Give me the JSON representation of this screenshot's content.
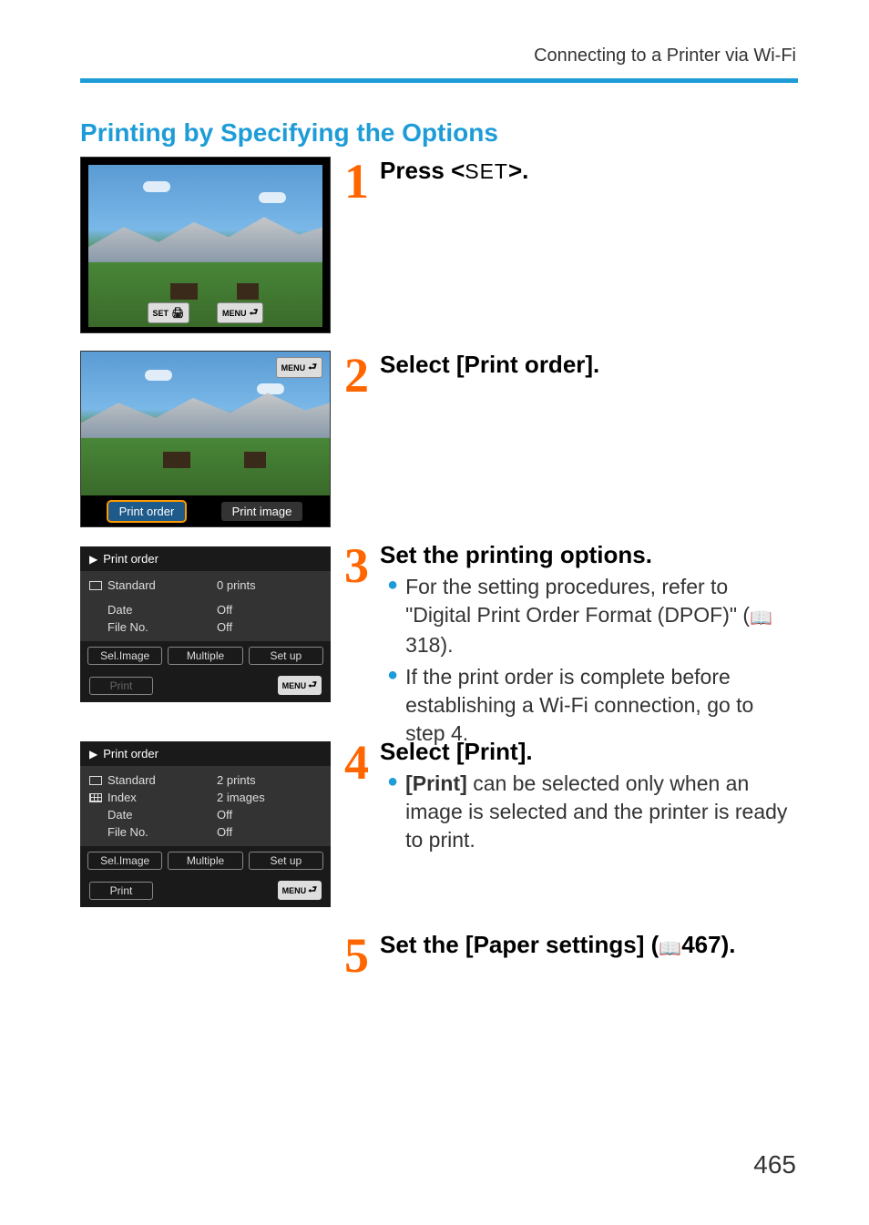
{
  "header": "Connecting to a Printer via Wi-Fi",
  "section_title": "Printing by Specifying the Options",
  "page_number": "465",
  "steps": {
    "s1": {
      "num": "1",
      "heading_prefix": "Press <",
      "heading_set": "SET",
      "heading_suffix": ">."
    },
    "s2": {
      "num": "2",
      "heading": "Select [Print order]."
    },
    "s3": {
      "num": "3",
      "heading": "Set the printing options.",
      "b1a": "For the setting procedures, refer to \"Digital Print Order Format (DPOF)\" (",
      "b1_ref": "318",
      "b1b": ").",
      "b2": "If the print order is complete before establishing a Wi-Fi connection, go to step 4."
    },
    "s4": {
      "num": "4",
      "heading": "Select [Print].",
      "b1_bold": "[Print]",
      "b1_rest": " can be selected only when an image is selected and the printer is ready to print."
    },
    "s5": {
      "num": "5",
      "heading_prefix": "Set the [Paper settings] (",
      "heading_ref": "467",
      "heading_suffix": ")."
    }
  },
  "cam1": {
    "set_label": "SET",
    "menu_label": "MENU"
  },
  "cam2": {
    "menu_label": "MENU",
    "tab_order": "Print order",
    "tab_image": "Print image"
  },
  "po3": {
    "title": "Print order",
    "rows": [
      {
        "label": "Standard",
        "value": "0 prints",
        "icon": "rect"
      },
      {
        "label": "Date",
        "value": "Off"
      },
      {
        "label": "File No.",
        "value": "Off"
      }
    ],
    "btns": [
      "Sel.Image",
      "Multiple",
      "Set up"
    ],
    "print": "Print",
    "menu_label": "MENU"
  },
  "po4": {
    "title": "Print order",
    "rows": [
      {
        "label": "Standard",
        "value": "2 prints",
        "icon": "rect"
      },
      {
        "label": "Index",
        "value": "2 images",
        "icon": "grid"
      },
      {
        "label": "Date",
        "value": "Off"
      },
      {
        "label": "File No.",
        "value": "Off"
      }
    ],
    "btns": [
      "Sel.Image",
      "Multiple",
      "Set up"
    ],
    "print": "Print",
    "menu_label": "MENU"
  }
}
